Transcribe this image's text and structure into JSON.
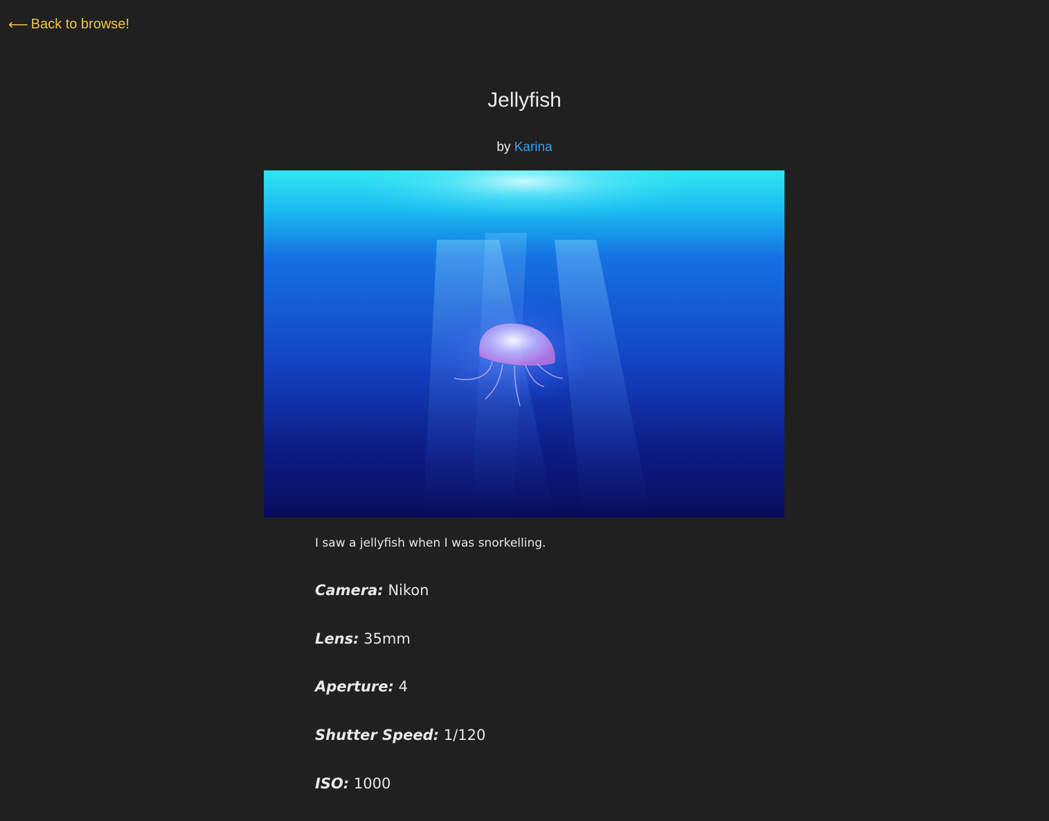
{
  "nav": {
    "back_icon": "⟵",
    "back_label": "Back to browse!"
  },
  "photo": {
    "title": "Jellyfish",
    "by_prefix": "by",
    "author": "Karina",
    "description": "I saw a jellyfish when I was snorkelling."
  },
  "specs": [
    {
      "label": "Camera:",
      "value": "Nikon"
    },
    {
      "label": "Lens:",
      "value": "35mm"
    },
    {
      "label": "Aperture:",
      "value": "4"
    },
    {
      "label": "Shutter Speed:",
      "value": "1/120"
    },
    {
      "label": "ISO:",
      "value": "1000"
    }
  ],
  "colors": {
    "background": "#202020",
    "back_link": "#f3c44a",
    "author_link": "#3a9ee6",
    "text": "#ececec"
  }
}
